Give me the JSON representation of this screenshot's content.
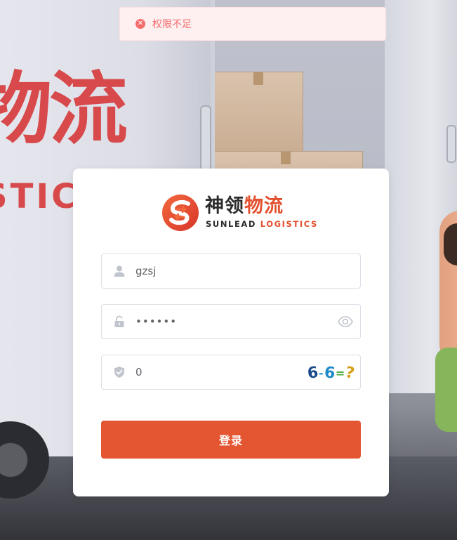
{
  "toast": {
    "message": "权限不足",
    "icon": "error-circle-icon",
    "color": "#f56c6c"
  },
  "background": {
    "truck_logo_cn": "物流",
    "truck_logo_en": "STICS"
  },
  "logo": {
    "cn_part1": "神领",
    "cn_part2": "物流",
    "en_part1": "SUNLEAD",
    "en_part2": "LOGISTICS",
    "brand_color": "#e2502f"
  },
  "form": {
    "username": {
      "icon": "user-icon",
      "value": "gzsj"
    },
    "password": {
      "icon": "lock-icon",
      "value": "••••••",
      "toggle_icon": "eye-icon"
    },
    "captcha": {
      "icon": "shield-icon",
      "value": "0",
      "image_text": [
        "6",
        "-",
        "6",
        "=",
        "?"
      ]
    },
    "submit_label": "登录",
    "submit_color": "#e45532"
  }
}
